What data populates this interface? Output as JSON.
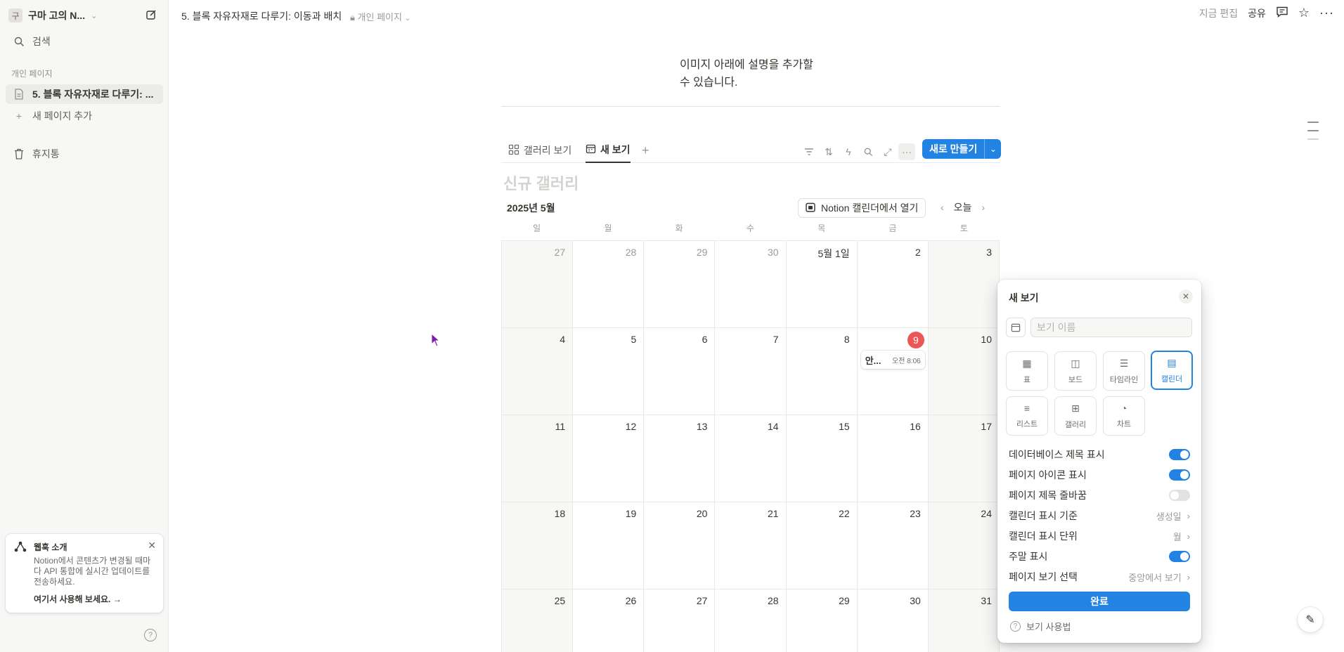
{
  "sidebar": {
    "workspace_avatar": "구",
    "workspace_name": "구마 고의 N...",
    "search_label": "검색",
    "section_label": "개인 페이지",
    "page_item": "5. 블록 자유자재로 다루기: ...",
    "add_page": "새 페이지 추가",
    "trash": "휴지통",
    "webhook": {
      "title": "웹훅 소개",
      "desc": "Notion에서 콘텐츠가 변경될 때마다 API 통합에 실시간 업데이트를 전송하세요.",
      "link": "여기서 사용해 보세요."
    }
  },
  "topbar": {
    "breadcrumb": "5. 블록 자유자재로 다루기: 이동과 배치",
    "privacy": "개인 페이지",
    "edited": "지금 편집",
    "share": "공유"
  },
  "content": {
    "caption": "이미지 아래에 설명을 추가할 수 있습니다."
  },
  "database": {
    "tabs": [
      {
        "label": "갤러리 보기"
      },
      {
        "label": "새 보기"
      }
    ],
    "new_button": "새로 만들기",
    "title_placeholder": "신규 갤러리",
    "month_label": "2025년 5월",
    "open_calendar": "Notion 캘린더에서 열기",
    "today": "오늘",
    "weekdays": [
      "일",
      "월",
      "화",
      "수",
      "목",
      "금",
      "토"
    ],
    "days": [
      "27",
      "28",
      "29",
      "30",
      "5월 1일",
      "2",
      "3",
      "4",
      "5",
      "6",
      "7",
      "8",
      "9",
      "10",
      "11",
      "12",
      "13",
      "14",
      "15",
      "16",
      "17",
      "18",
      "19",
      "20",
      "21",
      "22",
      "23",
      "24",
      "25",
      "26",
      "27",
      "28",
      "29",
      "30",
      "31"
    ],
    "event": {
      "name": "안...",
      "time": "오전 8:06"
    }
  },
  "popup": {
    "title": "새 보기",
    "name_placeholder": "보기 이름",
    "layouts": [
      "표",
      "보드",
      "타임라인",
      "캘린더",
      "리스트",
      "갤러리",
      "차트"
    ],
    "options": {
      "show_db_title": "데이터베이스 제목 표시",
      "show_page_icon": "페이지 아이콘 표시",
      "wrap_page_title": "페이지 제목 줄바꿈",
      "calendar_by": "캘린더 표시 기준",
      "calendar_by_value": "생성일",
      "calendar_unit": "캘린더 표시 단위",
      "calendar_unit_value": "월",
      "show_weekends": "주말 표시",
      "page_view": "페이지 보기 선택",
      "page_view_value": "중앙에서 보기"
    },
    "done": "완료",
    "howto": "보기 사용법"
  },
  "colors": {
    "accent": "#2383e2",
    "today": "#eb5757"
  }
}
